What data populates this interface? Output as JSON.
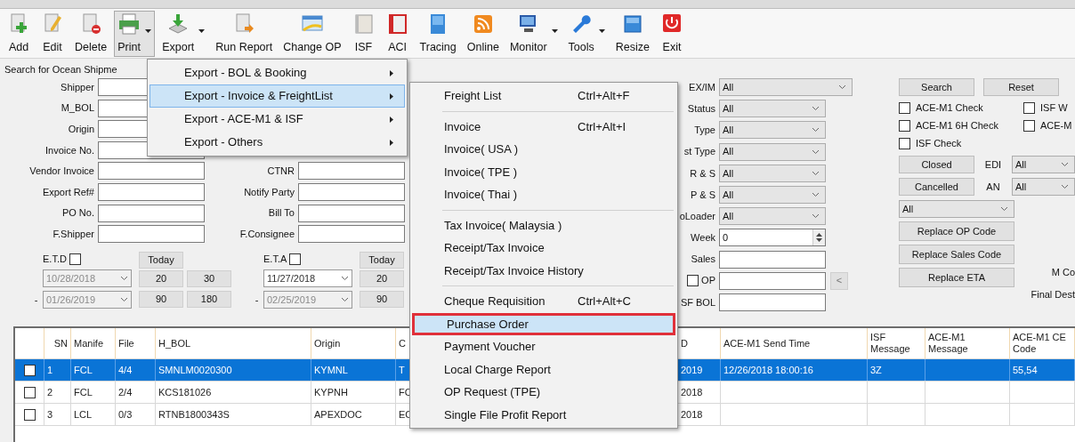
{
  "toolbar": [
    {
      "label": "Add",
      "dropdown": false,
      "selected": false
    },
    {
      "label": "Edit",
      "dropdown": false,
      "selected": false
    },
    {
      "label": "Delete",
      "dropdown": false,
      "selected": false
    },
    {
      "label": "Print",
      "dropdown": true,
      "selected": true
    },
    {
      "label": "Export",
      "dropdown": true,
      "selected": false
    },
    {
      "label": "Run Report",
      "dropdown": false,
      "selected": false
    },
    {
      "label": "Change OP",
      "dropdown": false,
      "selected": false
    },
    {
      "label": "ISF",
      "dropdown": false,
      "selected": false
    },
    {
      "label": "ACI",
      "dropdown": false,
      "selected": false
    },
    {
      "label": "Tracing",
      "dropdown": false,
      "selected": false
    },
    {
      "label": "Online",
      "dropdown": false,
      "selected": false
    },
    {
      "label": "Monitor",
      "dropdown": true,
      "selected": false
    },
    {
      "label": "Tools",
      "dropdown": true,
      "selected": false
    },
    {
      "label": "Resize",
      "dropdown": false,
      "selected": false
    },
    {
      "label": "Exit",
      "dropdown": false,
      "selected": false
    }
  ],
  "search_title": "Search for Ocean Shipme",
  "fields_left": [
    {
      "label": "Shipper"
    },
    {
      "label": "M_BOL"
    },
    {
      "label": "Origin"
    },
    {
      "label": "Invoice No."
    },
    {
      "label": "Vendor Invoice"
    },
    {
      "label": "Export Ref#"
    },
    {
      "label": "PO No."
    },
    {
      "label": "F.Shipper"
    }
  ],
  "fields_middle": [
    {
      "label": "CTNR"
    },
    {
      "label": "Notify Party"
    },
    {
      "label": "Bill To"
    },
    {
      "label": "F.Consignee"
    }
  ],
  "date_ranges": [
    {
      "label": "E.T.D",
      "checked": false,
      "dash": "-",
      "from": "10/28/2018",
      "to": "01/26/2019",
      "from_disabled": true,
      "buttons": [
        "Today",
        "20",
        "30",
        "90",
        "180"
      ]
    },
    {
      "label": "E.T.A",
      "checked": false,
      "dash": "-",
      "from": "11/27/2018",
      "to": "02/25/2019",
      "from_disabled": false,
      "buttons": [
        "Today",
        "20",
        "90"
      ]
    }
  ],
  "fields_right": [
    {
      "label": "EX/IM",
      "kind": "select",
      "value": "All"
    },
    {
      "label": "Status",
      "kind": "select",
      "value": "All"
    },
    {
      "label": "Type",
      "kind": "select",
      "value": "All"
    },
    {
      "label": "st Type",
      "kind": "select",
      "value": "All"
    },
    {
      "label": "R & S",
      "kind": "select",
      "value": "All"
    },
    {
      "label": "P & S",
      "kind": "select",
      "value": "All"
    },
    {
      "label": "oLoader",
      "kind": "select",
      "value": "All"
    },
    {
      "label": "Week",
      "kind": "spin",
      "value": "0"
    },
    {
      "label": "Sales",
      "kind": "text"
    },
    {
      "label": "OP",
      "kind": "checktext",
      "checked": false,
      "button": "<"
    },
    {
      "label": "SF BOL",
      "kind": "text"
    }
  ],
  "actions": {
    "search": "Search",
    "reset": "Reset",
    "checks": [
      {
        "label": "ACE-M1 Check",
        "checked": false
      },
      {
        "label": "ISF W",
        "checked": false
      },
      {
        "label": "ACE-M1 6H Check",
        "checked": false
      },
      {
        "label": "ACE-M",
        "checked": false
      },
      {
        "label": "ISF Check",
        "checked": false
      }
    ],
    "filters": [
      {
        "button": "Closed",
        "label": "EDI",
        "value": "All"
      },
      {
        "button": "Cancelled",
        "label": "AN",
        "value": "All"
      }
    ],
    "select_value": "All",
    "replace_buttons": [
      "Replace OP Code",
      "Replace Sales Code",
      "Replace ETA"
    ],
    "side_labels": [
      "M Co",
      "Final Dest"
    ]
  },
  "table": {
    "columns": [
      "SN",
      "Manife",
      "File",
      "H_BOL",
      "Origin",
      "C",
      "D",
      "ACE-M1 Send Time",
      "ISF Message",
      "ACE-M1 Message",
      "ACE-M1 CE Code"
    ],
    "rows": [
      {
        "selected": true,
        "checked": false,
        "sn": "1",
        "manifest": "FCL",
        "file": "4/4",
        "h_bol": "SMNLM0020300",
        "origin": "KYMNL",
        "column_7": "T",
        "column_9": "2019",
        "send_time": "12/26/2018 18:00:16",
        "isf_message": "3Z",
        "ce_code": "55,54"
      },
      {
        "selected": false,
        "checked": false,
        "sn": "2",
        "manifest": "FCL",
        "file": "2/4",
        "h_bol": "KCS181026",
        "origin": "KYPNH",
        "column_7": "FC",
        "column_9": "2018"
      },
      {
        "selected": false,
        "checked": false,
        "sn": "3",
        "manifest": "LCL",
        "file": "0/3",
        "h_bol": "RTNB1800343S",
        "origin": "APEXDOC",
        "column_7": "EC",
        "column_9": "2018"
      }
    ]
  },
  "print_menu": [
    {
      "label": "Export - BOL & Booking",
      "selected": false
    },
    {
      "label": "Export - Invoice & FreightList",
      "selected": true
    },
    {
      "label": "Export - ACE-M1 & ISF",
      "selected": false
    },
    {
      "label": "Export - Others",
      "selected": false
    }
  ],
  "submenu": [
    [
      {
        "label": "Freight List",
        "shortcut": "Ctrl+Alt+F",
        "selected": false,
        "outlined": false
      }
    ],
    [
      {
        "label": "Invoice",
        "shortcut": "Ctrl+Alt+I",
        "selected": false,
        "outlined": false
      },
      {
        "label": "Invoice( USA )",
        "selected": false,
        "outlined": false
      },
      {
        "label": "Invoice( TPE )",
        "selected": false,
        "outlined": false
      },
      {
        "label": "Invoice( Thai )",
        "selected": false,
        "outlined": false
      }
    ],
    [
      {
        "label": "Tax Invoice( Malaysia )",
        "selected": false,
        "outlined": false
      },
      {
        "label": "Receipt/Tax Invoice",
        "selected": false,
        "outlined": false
      },
      {
        "label": "Receipt/Tax Invoice History",
        "selected": false,
        "outlined": false
      }
    ],
    [
      {
        "label": "Cheque Requisition",
        "shortcut": "Ctrl+Alt+C",
        "selected": false,
        "outlined": false
      },
      {
        "label": "Purchase Order",
        "selected": true,
        "outlined": true
      },
      {
        "label": "Payment Voucher",
        "selected": false,
        "outlined": false
      },
      {
        "label": "Local Charge Report",
        "selected": false,
        "outlined": false
      },
      {
        "label": "OP Request (TPE)",
        "selected": false,
        "outlined": false
      },
      {
        "label": "Single File Profit Report",
        "selected": false,
        "outlined": false
      }
    ]
  ]
}
